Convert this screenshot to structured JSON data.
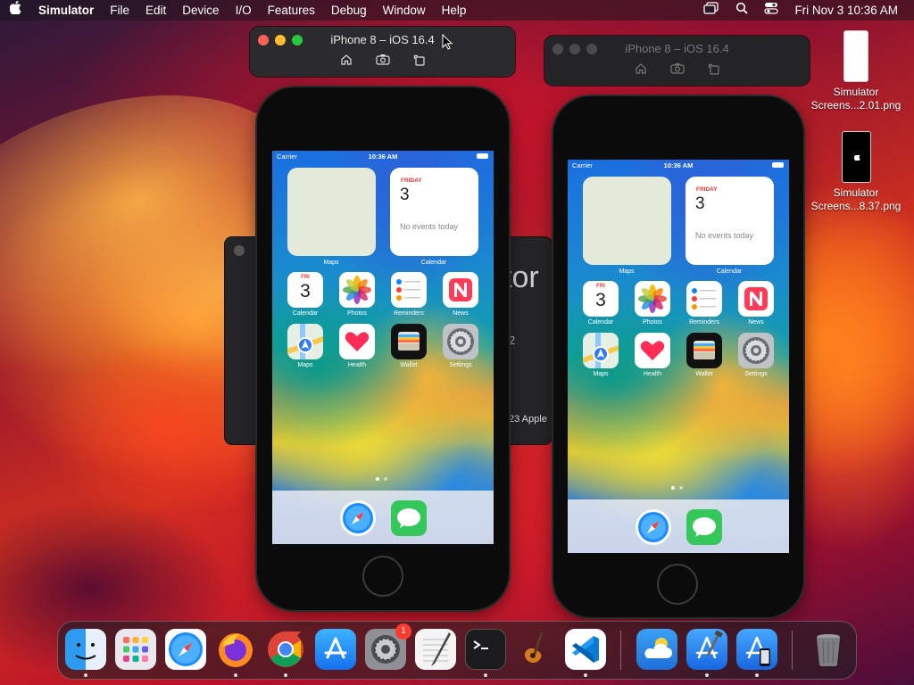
{
  "menubar": {
    "app_name": "Simulator",
    "menus": [
      "File",
      "Edit",
      "Device",
      "I/O",
      "Features",
      "Debug",
      "Window",
      "Help"
    ],
    "clock": "Fri Nov 3  10:36 AM"
  },
  "windows": [
    {
      "title": "iPhone 8 – iOS 16.4",
      "active": true
    },
    {
      "title": "iPhone 8 – iOS 16.4",
      "active": false
    }
  ],
  "about_window": {
    "partial_title": "tor",
    "partial_line1": "2",
    "partial_copyright": "23 Apple"
  },
  "phone": {
    "carrier": "Carrier",
    "time": "10:36 AM",
    "widgets": {
      "maps_label": "Maps",
      "calendar_label": "Calendar",
      "calendar_day": "FRIDAY",
      "calendar_date": "3",
      "calendar_events": "No events today"
    },
    "apps": [
      {
        "name": "Calendar",
        "icon": "calendar-icon",
        "badge_day": "FRI",
        "badge_num": "3"
      },
      {
        "name": "Photos",
        "icon": "photos-icon"
      },
      {
        "name": "Reminders",
        "icon": "reminders-icon"
      },
      {
        "name": "News",
        "icon": "news-icon"
      },
      {
        "name": "Maps",
        "icon": "maps-icon"
      },
      {
        "name": "Health",
        "icon": "health-icon"
      },
      {
        "name": "Wallet",
        "icon": "wallet-icon"
      },
      {
        "name": "Settings",
        "icon": "settings-icon"
      }
    ],
    "dock_apps": [
      "safari-icon",
      "messages-icon"
    ]
  },
  "desktop_files": [
    {
      "name_line1": "Simulator",
      "name_line2": "Screens...2.01.png"
    },
    {
      "name_line1": "Simulator",
      "name_line2": "Screens...8.37.png"
    }
  ],
  "dock": {
    "apps": [
      "finder-icon",
      "launchpad-icon",
      "safari-icon",
      "firefox-icon",
      "chrome-icon",
      "app-store-icon",
      "system-settings-icon",
      "textedit-icon",
      "terminal-icon",
      "garageband-icon",
      "vscode-icon",
      "weather-icon",
      "xcode-icon",
      "simulator-icon",
      "trash-icon"
    ],
    "settings_badge": "1"
  },
  "colors": {
    "close": "#ff5f57",
    "minimize": "#febc2e",
    "zoom": "#28c840",
    "accent": "#0a84ff"
  }
}
